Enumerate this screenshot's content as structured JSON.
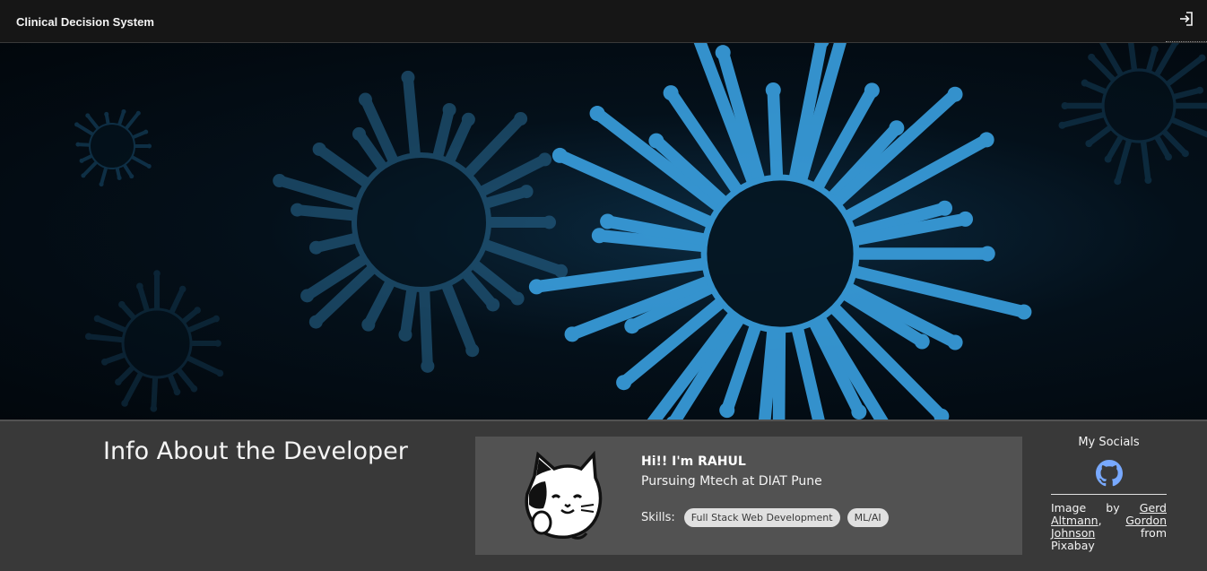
{
  "header": {
    "title": "Clinical Decision System",
    "login_icon": "login-icon"
  },
  "hero": {
    "image": "virus-illustration",
    "colors": {
      "glow": "#3aa0e0",
      "dark": "#02070c"
    }
  },
  "info": {
    "heading": "Info About the Developer"
  },
  "card": {
    "avatar_icon": "cat-avatar-icon",
    "greeting": "Hi!! I'm RAHUL",
    "subtitle": "Pursuing Mtech at DIAT Pune",
    "skills_label": "Skills:",
    "skills": [
      "Full Stack Web Development",
      "ML/AI"
    ]
  },
  "socials": {
    "title": "My Socials",
    "github_icon": "github-icon",
    "github_color": "#78a9ff",
    "credit": {
      "prefix": "Image by",
      "author_link": "Gerd Altmann",
      "separator": ",",
      "author2_link": "Gordon Johnson",
      "suffix": "from Pixabay"
    }
  }
}
